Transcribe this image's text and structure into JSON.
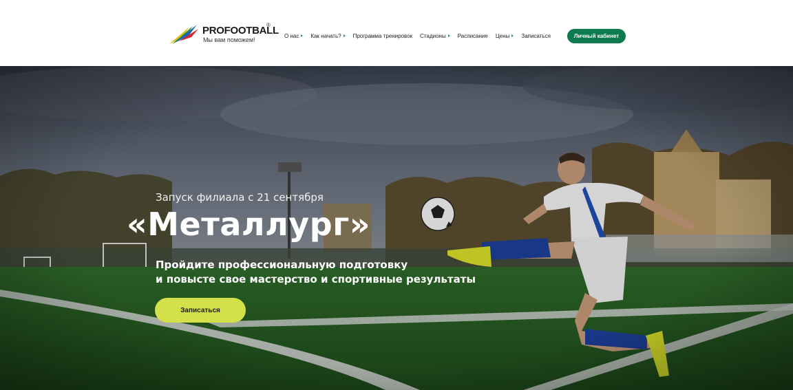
{
  "brand": {
    "name": "PROFOOTBALL",
    "registered_mark": "®",
    "tagline": "Мы вам поможем!"
  },
  "nav": [
    {
      "label": "О нас",
      "has_submenu": true
    },
    {
      "label": "Как начать?",
      "has_submenu": true
    },
    {
      "label": "Программа тренировок",
      "has_submenu": false
    },
    {
      "label": "Стадионы",
      "has_submenu": true
    },
    {
      "label": "Расписание",
      "has_submenu": false
    },
    {
      "label": "Цены",
      "has_submenu": true
    },
    {
      "label": "Записаться",
      "has_submenu": false
    }
  ],
  "header": {
    "cabinet_label": "Личный кабинет"
  },
  "hero": {
    "subtitle": "Запуск филиала с 21 сентября",
    "title": "«Металлург»",
    "desc_line1": "Пройдите профессиональную подготовку",
    "desc_line2": "и повысте свое мастерство и спортивные результаты",
    "cta_label": "Записаться"
  },
  "colors": {
    "accent_green": "#0e7a4f",
    "cta_yellow": "#d4e04a",
    "nav_caret": "#2a9a4a"
  }
}
